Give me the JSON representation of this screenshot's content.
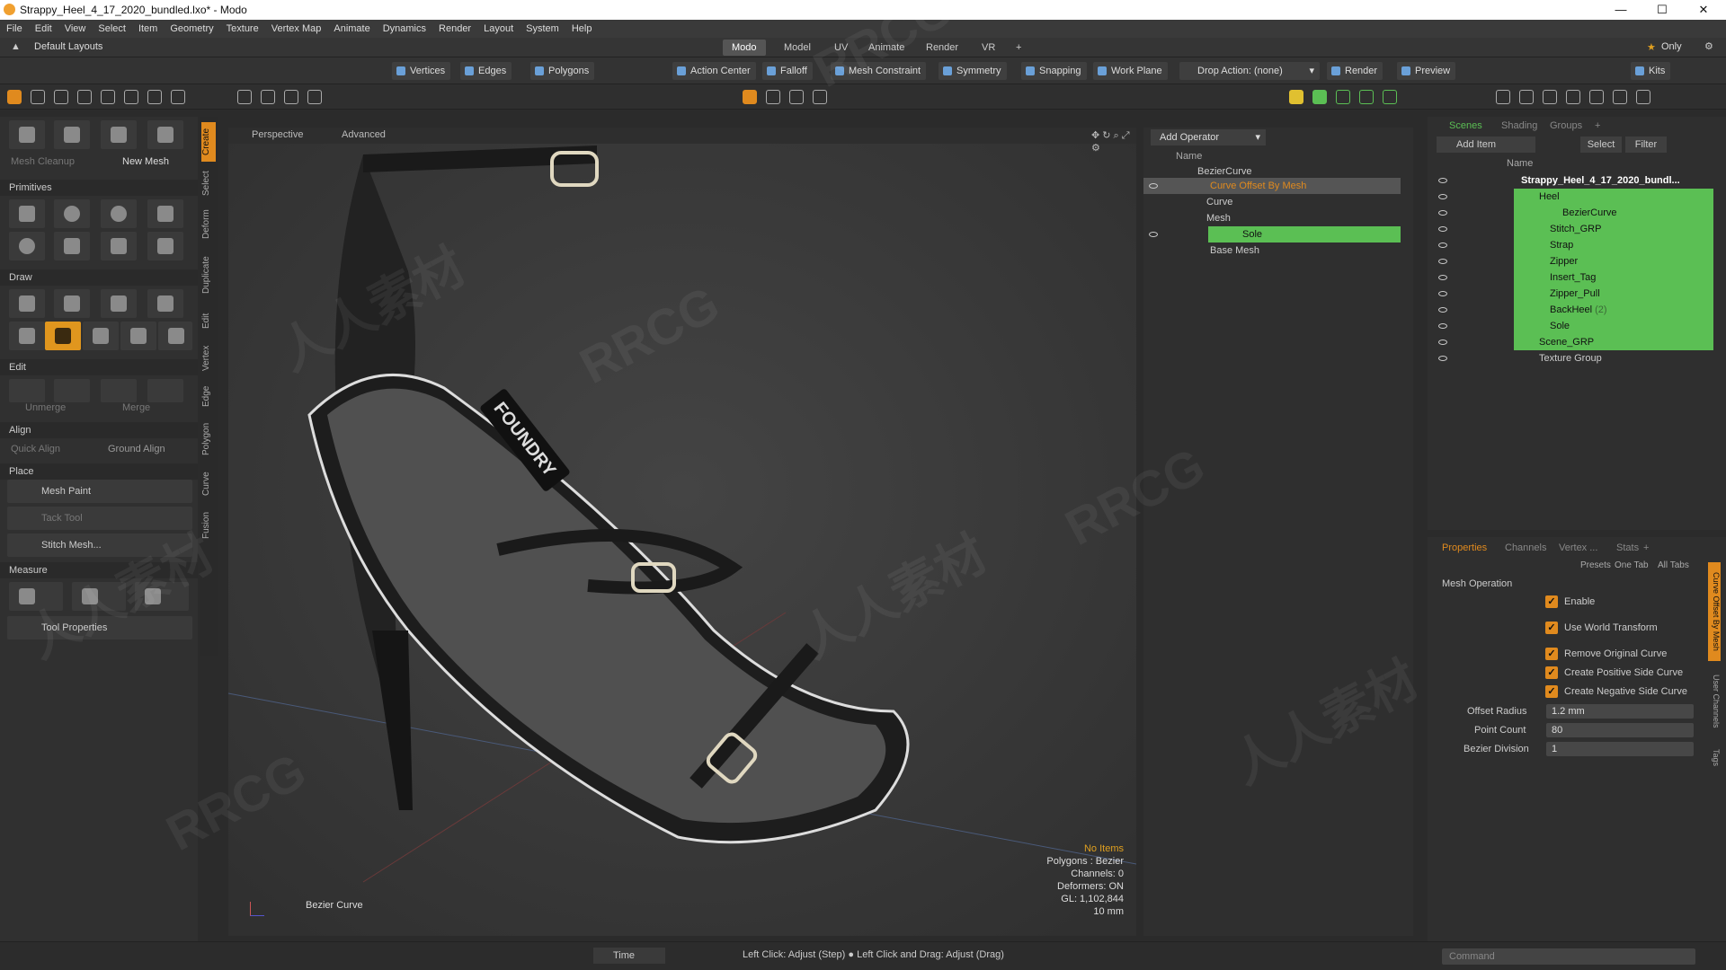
{
  "window": {
    "title": "Strappy_Heel_4_17_2020_bundled.lxo* - Modo",
    "minimize": "—",
    "maximize": "☐",
    "close": "✕"
  },
  "menu": [
    "File",
    "Edit",
    "View",
    "Select",
    "Item",
    "Geometry",
    "Texture",
    "Vertex Map",
    "Animate",
    "Dynamics",
    "Render",
    "Layout",
    "System",
    "Help"
  ],
  "layout": {
    "name": "Default Layouts",
    "tabs": [
      "Modo",
      "Model",
      "UV",
      "Animate",
      "Render",
      "VR",
      "+"
    ],
    "active_tab": "Modo",
    "only_label": "Only"
  },
  "toolbar": {
    "vertices": "Vertices",
    "edges": "Edges",
    "polygons": "Polygons",
    "action_center": "Action Center",
    "falloff": "Falloff",
    "mesh_constraint": "Mesh Constraint",
    "symmetry": "Symmetry",
    "snapping": "Snapping",
    "work_plane": "Work Plane",
    "drop_action": "Drop Action: (none)",
    "render": "Render",
    "preview": "Preview",
    "kits": "Kits"
  },
  "left": {
    "mesh_cleanup": "Mesh Cleanup",
    "new_mesh": "New Mesh",
    "primitives": "Primitives",
    "draw": "Draw",
    "edit": "Edit",
    "unmerge": "Unmerge",
    "merge": "Merge",
    "align": "Align",
    "quick_align": "Quick Align",
    "ground_align": "Ground Align",
    "place": "Place",
    "mesh_paint": "Mesh Paint",
    "tack_tool": "Tack Tool",
    "stitch_mesh": "Stitch Mesh...",
    "measure": "Measure",
    "tool_properties": "Tool Properties"
  },
  "vtabs": [
    "Create",
    "Select",
    "Deform",
    "Duplicate",
    "Edit",
    "Vertex",
    "Edge",
    "Polygon",
    "Curve",
    "Fusion"
  ],
  "viewport": {
    "mode": "Perspective",
    "style": "Advanced",
    "label": "Bezier Curve",
    "logo_text": "FOUNDRY",
    "info": {
      "no_items": "No Items",
      "polygons": "Polygons : Bezier",
      "channels": "Channels: 0",
      "deformers": "Deformers: ON",
      "gl": "GL: 1,102,844",
      "scale": "10 mm"
    }
  },
  "operators": {
    "add": "Add Operator",
    "col": "Name",
    "items": [
      "BezierCurve",
      "Curve Offset By Mesh",
      "Curve",
      "Mesh",
      "Sole",
      "Base Mesh"
    ]
  },
  "scene": {
    "tabs": [
      "Scenes",
      "Shading",
      "Groups",
      "+"
    ],
    "add_item": "Add Item",
    "select": "Select",
    "filter": "Filter",
    "col": "Name",
    "items": [
      "Strappy_Heel_4_17_2020_bundl...",
      "Heel",
      "BezierCurve",
      "Stitch_GRP",
      "Strap",
      "Zipper",
      "Insert_Tag",
      "Zipper_Pull",
      "BackHeel",
      "Sole",
      "Scene_GRP",
      "Texture Group"
    ],
    "backheel_count": "(2)"
  },
  "props": {
    "tabs": [
      "Properties",
      "Channels",
      "Vertex ...",
      "Stats",
      "+"
    ],
    "presets": "Presets",
    "one_tab": "One Tab",
    "all_tabs": "All Tabs",
    "section": "Mesh Operation",
    "enable": "Enable",
    "world": "Use World Transform",
    "remove": "Remove Original Curve",
    "pos": "Create Positive Side Curve",
    "neg": "Create Negative Side Curve",
    "offset_label": "Offset Radius",
    "offset_val": "1.2 mm",
    "count_label": "Point Count",
    "count_val": "80",
    "div_label": "Bezier Division",
    "div_val": "1",
    "side_tabs": [
      "Curve Offset By Mesh",
      "User Channels",
      "Tags"
    ]
  },
  "status": {
    "time": "Time",
    "hint": "Left Click: Adjust (Step) ● Left Click and Drag: Adjust (Drag)",
    "command": "Command"
  },
  "watermark": [
    "RRCG",
    "人人素材"
  ],
  "colors": {
    "accent": "#e08a1e",
    "selected": "#5bbf54",
    "blue": "#6aa0d8"
  }
}
